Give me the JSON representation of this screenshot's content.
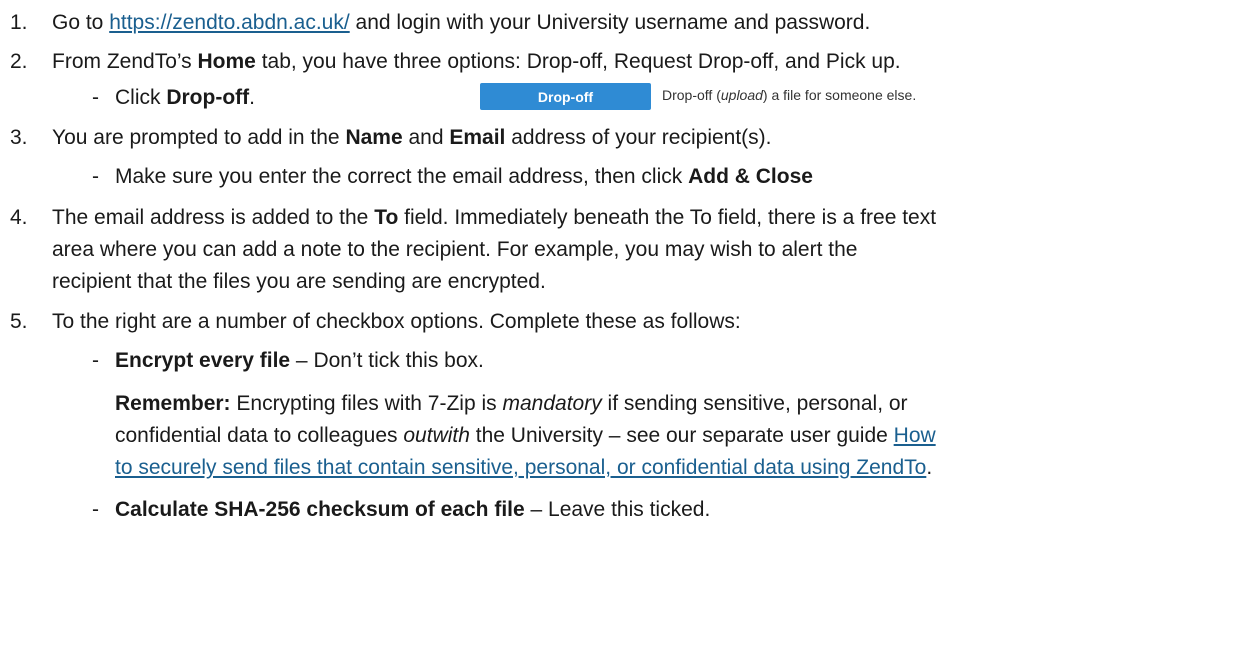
{
  "steps": [
    {
      "num": "1.",
      "pre": "Go to ",
      "link": "https://zendto.abdn.ac.uk/",
      "post": " and login with your University username and password."
    },
    {
      "num": "2.",
      "pre": "From ZendTo’s ",
      "bold": "Home",
      "post": " tab, you have three options: Drop-off, Request Drop-off, and Pick up.",
      "sub": {
        "dash": "-",
        "pre": "Click ",
        "bold": "Drop-off",
        "post": ".",
        "screenshot_button": "Drop-off",
        "screenshot_desc_pre": "Drop-off (",
        "screenshot_desc_italic": "upload",
        "screenshot_desc_post": ") a file for someone else."
      }
    },
    {
      "num": "3.",
      "pre": "You are prompted to add in the ",
      "bold1": "Name",
      "mid": " and ",
      "bold2": "Email",
      "post": " address of your recipient(s).",
      "sub": {
        "dash": "-",
        "pre": "Make sure you enter the correct the email address, then click ",
        "bold": "Add & Close"
      }
    },
    {
      "num": "4.",
      "pre": "The email address is added to the ",
      "bold": "To",
      "post": " field. Immediately beneath the To field, there is a free text",
      "line2": "area where you can add a note to the recipient. For example, you may wish to alert the",
      "line3": "recipient that the files you are sending are encrypted."
    },
    {
      "num": "5.",
      "text": "To the right are a number of checkbox options. Complete these as follows:",
      "sub1": {
        "dash": "-",
        "bold": "Encrypt every file",
        "post": " – Don’t tick this box."
      },
      "remember": {
        "bold": "Remember:",
        "pre": " Encrypting files with 7-Zip is ",
        "italic1": "mandatory",
        "mid": " if sending sensitive, personal, or",
        "line2_pre": "confidential data to colleagues ",
        "italic2": "outwith",
        "line2_mid": " the University – see our separate user guide ",
        "link_part1": "How",
        "link_part2": "to securely send files that contain sensitive, personal, or confidential data using ZendTo",
        "line3_post": "."
      },
      "sub2": {
        "dash": "-",
        "bold": "Calculate SHA-256 checksum of each file",
        "post": " – Leave this ticked."
      }
    }
  ]
}
